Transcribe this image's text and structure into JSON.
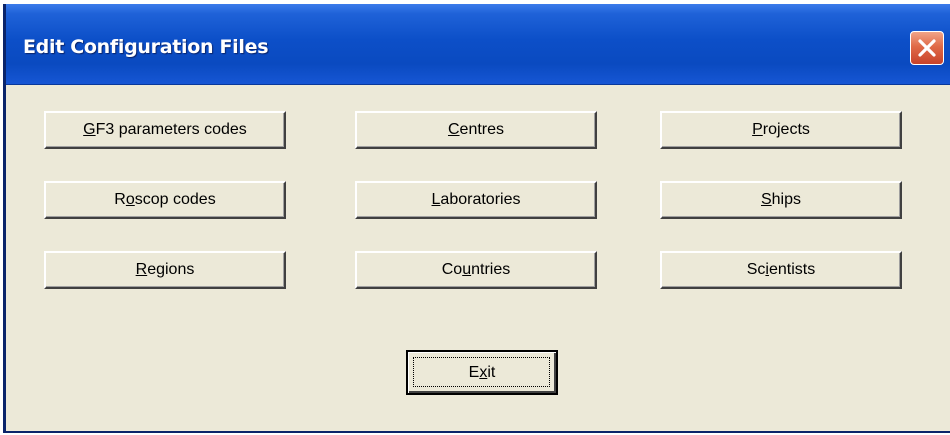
{
  "window": {
    "title": "Edit Configuration Files"
  },
  "buttons": {
    "gf3": {
      "pre": "",
      "acc": "G",
      "post": "F3 parameters codes"
    },
    "centres": {
      "pre": "",
      "acc": "C",
      "post": "entres"
    },
    "projects": {
      "pre": "",
      "acc": "P",
      "post": "rojects"
    },
    "roscop": {
      "pre": "R",
      "acc": "o",
      "post": "scop codes"
    },
    "laboratories": {
      "pre": "",
      "acc": "L",
      "post": "aboratories"
    },
    "ships": {
      "pre": "",
      "acc": "S",
      "post": "hips"
    },
    "regions": {
      "pre": "",
      "acc": "R",
      "post": "egions"
    },
    "countries": {
      "pre": "Co",
      "acc": "u",
      "post": "ntries"
    },
    "scientists": {
      "pre": "Sc",
      "acc": "i",
      "post": "entists"
    },
    "exit": {
      "pre": "E",
      "acc": "x",
      "post": "it"
    }
  },
  "icons": {
    "close": "close-x-icon"
  },
  "colors": {
    "titlebar": "#0c4fc8",
    "dialog_face": "#ece9d8",
    "close_button": "#e06a48"
  }
}
